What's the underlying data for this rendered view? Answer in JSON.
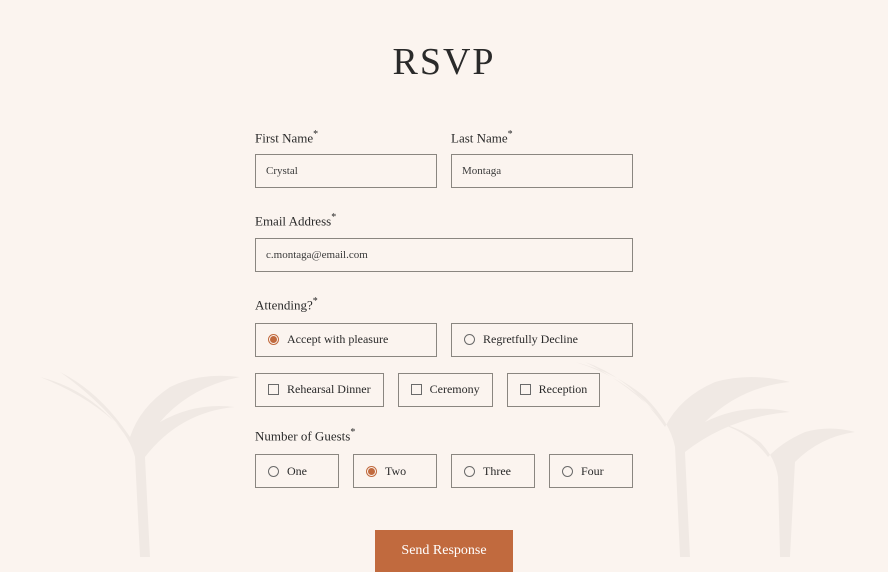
{
  "title": "RSVP",
  "fields": {
    "firstName": {
      "label": "First Name",
      "value": "Crystal"
    },
    "lastName": {
      "label": "Last Name",
      "value": "Montaga"
    },
    "email": {
      "label": "Email Address",
      "value": "c.montaga@email.com"
    }
  },
  "attending": {
    "label": "Attending?",
    "options": {
      "accept": "Accept with pleasure",
      "decline": "Regretfully Decline"
    },
    "selected": "accept"
  },
  "events": {
    "rehearsal": "Rehearsal Dinner",
    "ceremony": "Ceremony",
    "reception": "Reception"
  },
  "guests": {
    "label": "Number of Guests",
    "options": {
      "one": "One",
      "two": "Two",
      "three": "Three",
      "four": "Four"
    },
    "selected": "two"
  },
  "submit": "Send Response",
  "requiredMark": "*"
}
